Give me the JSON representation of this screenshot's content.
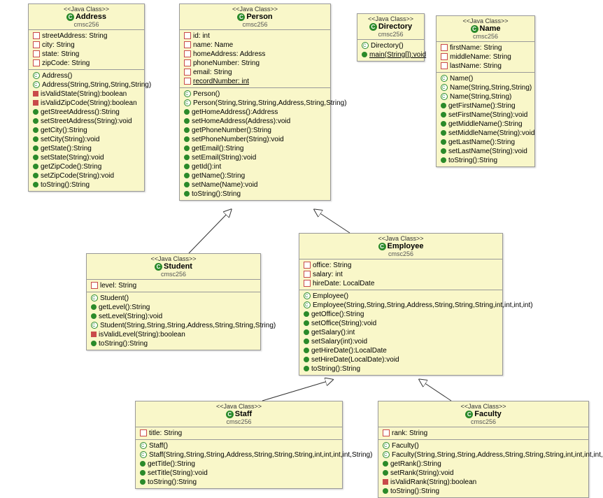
{
  "stereotype": "<<Java Class>>",
  "package": "cmsc256",
  "classes": {
    "address": {
      "name": "Address",
      "fields": [
        {
          "vis": "private",
          "sig": "streetAddress: String"
        },
        {
          "vis": "private",
          "sig": "city: String"
        },
        {
          "vis": "private",
          "sig": "state: String"
        },
        {
          "vis": "private",
          "sig": "zipCode: String"
        }
      ],
      "methods": [
        {
          "vis": "ctor",
          "sig": "Address()"
        },
        {
          "vis": "ctor",
          "sig": "Address(String,String,String,String)"
        },
        {
          "vis": "static-red",
          "sig": "isValidState(String):boolean"
        },
        {
          "vis": "static-red",
          "sig": "isValidZipCode(String):boolean"
        },
        {
          "vis": "public",
          "sig": "getStreetAddress():String"
        },
        {
          "vis": "public",
          "sig": "setStreetAddress(String):void"
        },
        {
          "vis": "public",
          "sig": "getCity():String"
        },
        {
          "vis": "public",
          "sig": "setCity(String):void"
        },
        {
          "vis": "public",
          "sig": "getState():String"
        },
        {
          "vis": "public",
          "sig": "setState(String):void"
        },
        {
          "vis": "public",
          "sig": "getZipCode():String"
        },
        {
          "vis": "public",
          "sig": "setZipCode(String):void"
        },
        {
          "vis": "public",
          "sig": "toString():String"
        }
      ]
    },
    "person": {
      "name": "Person",
      "fields": [
        {
          "vis": "private",
          "sig": "id: int"
        },
        {
          "vis": "private",
          "sig": "name: Name"
        },
        {
          "vis": "private",
          "sig": "homeAddress: Address"
        },
        {
          "vis": "private",
          "sig": "phoneNumber: String"
        },
        {
          "vis": "private",
          "sig": "email: String"
        },
        {
          "vis": "private",
          "sig": "recordNumber: int",
          "underline": true
        }
      ],
      "methods": [
        {
          "vis": "ctor",
          "sig": "Person()"
        },
        {
          "vis": "ctor",
          "sig": "Person(String,String,String,Address,String,String)"
        },
        {
          "vis": "public",
          "sig": "getHomeAddress():Address"
        },
        {
          "vis": "public",
          "sig": "setHomeAddress(Address):void"
        },
        {
          "vis": "public",
          "sig": "getPhoneNumber():String"
        },
        {
          "vis": "public",
          "sig": "setPhoneNumber(String):void"
        },
        {
          "vis": "public",
          "sig": "getEmail():String"
        },
        {
          "vis": "public",
          "sig": "setEmail(String):void"
        },
        {
          "vis": "public",
          "sig": "getId():int"
        },
        {
          "vis": "public",
          "sig": "getName():String"
        },
        {
          "vis": "public",
          "sig": "setName(Name):void"
        },
        {
          "vis": "public",
          "sig": "toString():String"
        }
      ]
    },
    "directory": {
      "name": "Directory",
      "methods": [
        {
          "vis": "ctor",
          "sig": "Directory()"
        },
        {
          "vis": "public",
          "sig": "main(String[]):void",
          "underline": true
        }
      ]
    },
    "nameClass": {
      "name": "Name",
      "fields": [
        {
          "vis": "private",
          "sig": "firstName: String"
        },
        {
          "vis": "private",
          "sig": "middleName: String"
        },
        {
          "vis": "private",
          "sig": "lastName: String"
        }
      ],
      "methods": [
        {
          "vis": "ctor",
          "sig": "Name()"
        },
        {
          "vis": "ctor",
          "sig": "Name(String,String,String)"
        },
        {
          "vis": "ctor",
          "sig": "Name(String,String)"
        },
        {
          "vis": "public",
          "sig": "getFirstName():String"
        },
        {
          "vis": "public",
          "sig": "setFirstName(String):void"
        },
        {
          "vis": "public",
          "sig": "getMiddleName():String"
        },
        {
          "vis": "public",
          "sig": "setMiddleName(String):void"
        },
        {
          "vis": "public",
          "sig": "getLastName():String"
        },
        {
          "vis": "public",
          "sig": "setLastName(String):void"
        },
        {
          "vis": "public",
          "sig": "toString():String"
        }
      ]
    },
    "student": {
      "name": "Student",
      "fields": [
        {
          "vis": "private",
          "sig": "level: String"
        }
      ],
      "methods": [
        {
          "vis": "ctor",
          "sig": "Student()"
        },
        {
          "vis": "public",
          "sig": "getLevel():String"
        },
        {
          "vis": "public",
          "sig": "setLevel(String):void"
        },
        {
          "vis": "ctor",
          "sig": "Student(String,String,String,Address,String,String,String)"
        },
        {
          "vis": "static-red",
          "sig": "isValidLevel(String):boolean"
        },
        {
          "vis": "public",
          "sig": "toString():String"
        }
      ]
    },
    "employee": {
      "name": "Employee",
      "fields": [
        {
          "vis": "private",
          "sig": "office: String"
        },
        {
          "vis": "private",
          "sig": "salary: int"
        },
        {
          "vis": "private",
          "sig": "hireDate: LocalDate"
        }
      ],
      "methods": [
        {
          "vis": "ctor",
          "sig": "Employee()"
        },
        {
          "vis": "ctor",
          "sig": "Employee(String,String,String,Address,String,String,String,int,int,int,int)"
        },
        {
          "vis": "public",
          "sig": "getOffice():String"
        },
        {
          "vis": "public",
          "sig": "setOffice(String):void"
        },
        {
          "vis": "public",
          "sig": "getSalary():int"
        },
        {
          "vis": "public",
          "sig": "setSalary(int):void"
        },
        {
          "vis": "public",
          "sig": "getHireDate():LocalDate"
        },
        {
          "vis": "public",
          "sig": "setHireDate(LocalDate):void"
        },
        {
          "vis": "public",
          "sig": "toString():String"
        }
      ]
    },
    "staff": {
      "name": "Staff",
      "fields": [
        {
          "vis": "private",
          "sig": "title: String"
        }
      ],
      "methods": [
        {
          "vis": "ctor",
          "sig": "Staff()"
        },
        {
          "vis": "ctor",
          "sig": "Staff(String,String,String,Address,String,String,String,int,int,int,int,String)"
        },
        {
          "vis": "public",
          "sig": "getTitle():String"
        },
        {
          "vis": "public",
          "sig": "setTitle(String):void"
        },
        {
          "vis": "public",
          "sig": "toString():String"
        }
      ]
    },
    "faculty": {
      "name": "Faculty",
      "fields": [
        {
          "vis": "private",
          "sig": "rank: String"
        }
      ],
      "methods": [
        {
          "vis": "ctor",
          "sig": "Faculty()"
        },
        {
          "vis": "ctor",
          "sig": "Faculty(String,String,String,Address,String,String,String,int,int,int,int,String)"
        },
        {
          "vis": "public",
          "sig": "getRank():String"
        },
        {
          "vis": "public",
          "sig": "setRank(String):void"
        },
        {
          "vis": "static-red",
          "sig": "isValidRank(String):boolean"
        },
        {
          "vis": "public",
          "sig": "toString():String"
        }
      ]
    }
  },
  "relations": [
    {
      "from": "Student",
      "to": "Person",
      "type": "generalization"
    },
    {
      "from": "Employee",
      "to": "Person",
      "type": "generalization"
    },
    {
      "from": "Staff",
      "to": "Employee",
      "type": "generalization"
    },
    {
      "from": "Faculty",
      "to": "Employee",
      "type": "generalization"
    }
  ]
}
